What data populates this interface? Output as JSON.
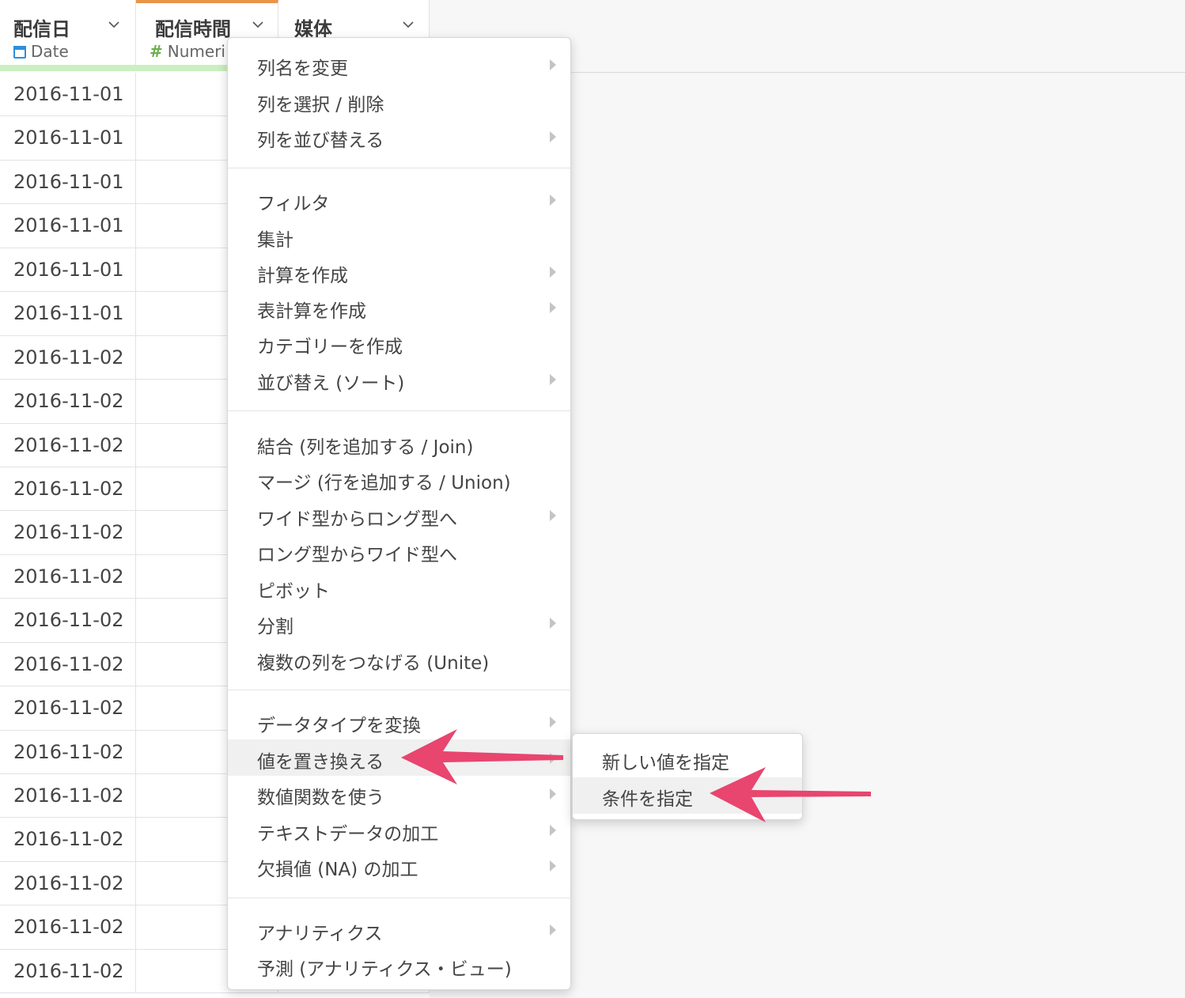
{
  "columns": [
    {
      "name": "配信日",
      "type_label": "Date",
      "type_icon": "calendar-icon"
    },
    {
      "name": "配信時間",
      "type_label": "Numeri",
      "type_icon": "hash-icon"
    },
    {
      "name": "媒体",
      "type_label": "",
      "type_icon": ""
    }
  ],
  "rows": [
    "2016-11-01",
    "2016-11-01",
    "2016-11-01",
    "2016-11-01",
    "2016-11-01",
    "2016-11-01",
    "2016-11-02",
    "2016-11-02",
    "2016-11-02",
    "2016-11-02",
    "2016-11-02",
    "2016-11-02",
    "2016-11-02",
    "2016-11-02",
    "2016-11-02",
    "2016-11-02",
    "2016-11-02",
    "2016-11-02",
    "2016-11-02",
    "2016-11-02",
    "2016-11-02"
  ],
  "menu": {
    "items": [
      {
        "label": "列名を変更",
        "submenu": true
      },
      {
        "label": "列を選択 / 削除",
        "submenu": false
      },
      {
        "label": "列を並び替える",
        "submenu": true
      },
      {
        "label": "フィルタ",
        "submenu": true
      },
      {
        "label": "集計",
        "submenu": false
      },
      {
        "label": "計算を作成",
        "submenu": true
      },
      {
        "label": "表計算を作成",
        "submenu": true
      },
      {
        "label": "カテゴリーを作成",
        "submenu": false
      },
      {
        "label": "並び替え (ソート)",
        "submenu": true
      },
      {
        "label": "結合 (列を追加する / Join)",
        "submenu": false
      },
      {
        "label": "マージ (行を追加する / Union)",
        "submenu": false
      },
      {
        "label": "ワイド型からロング型へ",
        "submenu": true
      },
      {
        "label": "ロング型からワイド型へ",
        "submenu": false
      },
      {
        "label": "ピボット",
        "submenu": false
      },
      {
        "label": "分割",
        "submenu": true
      },
      {
        "label": "複数の列をつなげる (Unite)",
        "submenu": false
      },
      {
        "label": "データタイプを変換",
        "submenu": true
      },
      {
        "label": "値を置き換える",
        "submenu": true,
        "highlighted": true
      },
      {
        "label": "数値関数を使う",
        "submenu": true
      },
      {
        "label": "テキストデータの加工",
        "submenu": true
      },
      {
        "label": "欠損値 (NA) の加工",
        "submenu": true
      },
      {
        "label": "アナリティクス",
        "submenu": true
      },
      {
        "label": "予測 (アナリティクス・ビュー)",
        "submenu": false
      }
    ]
  },
  "submenu": {
    "items": [
      {
        "label": "新しい値を指定"
      },
      {
        "label": "条件を指定",
        "highlighted": true
      }
    ]
  },
  "colors": {
    "accent_column_top": "#e8944a",
    "date_icon": "#2f8fd8",
    "numeric_icon": "#6ab04c",
    "valid_bar": "#c9f0c0",
    "annotation_arrow": "#e8456f"
  }
}
